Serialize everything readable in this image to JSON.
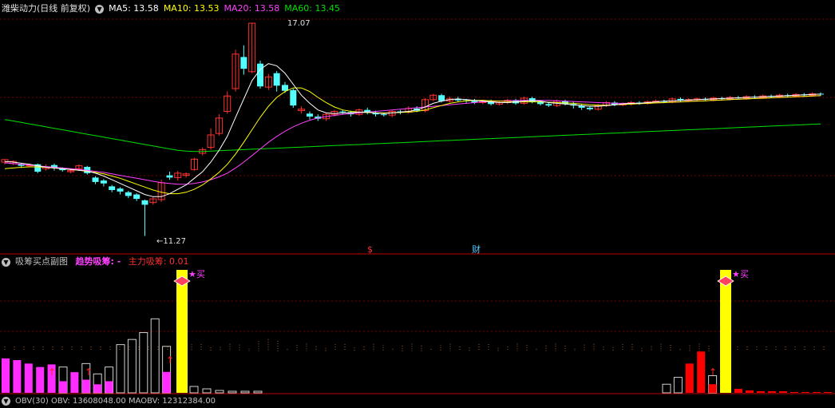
{
  "header": {
    "stock_title": "潍柴动力(日线 前复权)",
    "ma5": "MA5: 13.58",
    "ma10": "MA10: 13.53",
    "ma20": "MA20: 13.58",
    "ma60": "MA60: 13.45"
  },
  "sub_header": {
    "name": "吸筹买点副图",
    "trend_label": "趋势吸筹: -",
    "main_label": "主力吸筹: 0.01"
  },
  "obv_header": {
    "text": "OBV(30)  OBV: 13608048.00  MAOBV: 12312384.00"
  },
  "annotations": {
    "high_label": "17.07",
    "low_label": "←11.27",
    "marker_s": "$",
    "marker_cai": "财",
    "buy_label": "买"
  },
  "colors": {
    "up": "#ff3232",
    "down": "#54ffff",
    "ma5": "#ffffff",
    "ma10": "#ffff00",
    "ma20": "#ff40ff",
    "ma60": "#00e000",
    "grid": "#7a0000",
    "highlight": "#ffff00",
    "magenta": "#ff2dff",
    "red": "#ff0000"
  },
  "chart_data": {
    "type": "candlestick",
    "ylim": [
      11.0,
      17.3
    ],
    "candles": [
      [
        13.28,
        13.35,
        13.22,
        13.36
      ],
      [
        13.24,
        13.3,
        13.2,
        13.33
      ],
      [
        13.22,
        13.18,
        13.12,
        13.25
      ],
      [
        13.18,
        13.2,
        13.14,
        13.24
      ],
      [
        13.22,
        13.02,
        12.98,
        13.24
      ],
      [
        13.1,
        13.14,
        13.05,
        13.22
      ],
      [
        13.2,
        13.12,
        13.05,
        13.24
      ],
      [
        13.1,
        13.06,
        13.02,
        13.14
      ],
      [
        13.02,
        13.05,
        12.98,
        13.08
      ],
      [
        13.1,
        13.18,
        13.04,
        13.22
      ],
      [
        13.15,
        12.98,
        12.94,
        13.18
      ],
      [
        12.86,
        12.74,
        12.68,
        12.9
      ],
      [
        12.78,
        12.7,
        12.62,
        12.82
      ],
      [
        12.62,
        12.52,
        12.46,
        12.66
      ],
      [
        12.56,
        12.48,
        12.4,
        12.6
      ],
      [
        12.46,
        12.36,
        12.3,
        12.5
      ],
      [
        12.4,
        12.28,
        12.22,
        12.43
      ],
      [
        12.24,
        12.12,
        11.27,
        12.26
      ],
      [
        12.18,
        12.28,
        12.12,
        12.34
      ],
      [
        12.26,
        12.72,
        12.2,
        12.8
      ],
      [
        12.92,
        12.86,
        12.8,
        13.02
      ],
      [
        12.86,
        12.98,
        12.78,
        13.04
      ],
      [
        12.92,
        12.96,
        12.86,
        13.0
      ],
      [
        13.08,
        13.36,
        13.04,
        13.4
      ],
      [
        13.52,
        13.62,
        13.46,
        13.68
      ],
      [
        13.68,
        14.02,
        13.62,
        14.2
      ],
      [
        14.06,
        14.48,
        14.0,
        14.58
      ],
      [
        14.66,
        15.08,
        14.6,
        15.2
      ],
      [
        15.28,
        16.22,
        15.2,
        16.34
      ],
      [
        16.14,
        15.82,
        15.66,
        16.46
      ],
      [
        15.74,
        17.06,
        15.7,
        17.07
      ],
      [
        15.96,
        15.34,
        15.28,
        16.04
      ],
      [
        15.32,
        15.6,
        15.24,
        15.68
      ],
      [
        15.7,
        15.36,
        15.2,
        15.76
      ],
      [
        15.38,
        15.22,
        15.16,
        15.46
      ],
      [
        15.24,
        14.82,
        14.76,
        15.28
      ],
      [
        14.68,
        14.72,
        14.6,
        14.8
      ],
      [
        14.6,
        14.52,
        14.44,
        14.66
      ],
      [
        14.52,
        14.46,
        14.4,
        14.58
      ],
      [
        14.46,
        14.58,
        14.4,
        14.62
      ],
      [
        14.58,
        14.66,
        14.52,
        14.7
      ],
      [
        14.66,
        14.64,
        14.58,
        14.7
      ],
      [
        14.64,
        14.58,
        14.52,
        14.68
      ],
      [
        14.58,
        14.7,
        14.54,
        14.74
      ],
      [
        14.7,
        14.62,
        14.58,
        14.76
      ],
      [
        14.62,
        14.58,
        14.52,
        14.68
      ],
      [
        14.58,
        14.56,
        14.52,
        14.62
      ],
      [
        14.56,
        14.66,
        14.5,
        14.7
      ],
      [
        14.66,
        14.64,
        14.58,
        14.7
      ],
      [
        14.64,
        14.74,
        14.6,
        14.8
      ],
      [
        14.74,
        14.68,
        14.64,
        14.8
      ],
      [
        14.68,
        14.98,
        14.64,
        15.02
      ],
      [
        14.98,
        15.1,
        14.94,
        15.14
      ],
      [
        15.1,
        14.94,
        14.9,
        15.14
      ],
      [
        14.94,
        15.0,
        14.9,
        15.06
      ],
      [
        15.0,
        14.96,
        14.92,
        15.06
      ],
      [
        14.96,
        14.94,
        14.88,
        15.0
      ],
      [
        14.94,
        14.9,
        14.86,
        15.0
      ],
      [
        14.9,
        14.94,
        14.86,
        14.98
      ],
      [
        14.94,
        14.86,
        14.82,
        14.98
      ],
      [
        14.86,
        14.9,
        14.82,
        14.94
      ],
      [
        14.9,
        14.96,
        14.86,
        15.0
      ],
      [
        14.96,
        14.88,
        14.84,
        15.0
      ],
      [
        14.88,
        15.02,
        14.84,
        15.06
      ],
      [
        15.02,
        14.92,
        14.88,
        15.06
      ],
      [
        14.92,
        14.86,
        14.82,
        14.96
      ],
      [
        14.86,
        14.82,
        14.78,
        14.92
      ],
      [
        14.82,
        14.94,
        14.78,
        14.98
      ],
      [
        14.94,
        14.86,
        14.82,
        14.98
      ],
      [
        14.86,
        14.82,
        14.74,
        14.92
      ],
      [
        14.82,
        14.76,
        14.7,
        14.86
      ],
      [
        14.76,
        14.72,
        14.68,
        14.8
      ],
      [
        14.72,
        14.82,
        14.68,
        14.86
      ],
      [
        14.82,
        14.9,
        14.78,
        14.94
      ],
      [
        14.9,
        14.84,
        14.8,
        14.94
      ],
      [
        14.84,
        14.86,
        14.8,
        14.9
      ],
      [
        14.86,
        14.9,
        14.82,
        14.94
      ],
      [
        14.9,
        14.88,
        14.84,
        14.94
      ],
      [
        14.88,
        14.92,
        14.84,
        14.96
      ],
      [
        14.92,
        14.94,
        14.88,
        14.98
      ],
      [
        14.94,
        14.92,
        14.88,
        14.98
      ],
      [
        14.92,
        15.0,
        14.88,
        15.04
      ],
      [
        15.0,
        14.96,
        14.92,
        15.04
      ],
      [
        14.96,
        14.98,
        14.92,
        15.02
      ],
      [
        14.98,
        15.0,
        14.94,
        15.04
      ],
      [
        15.0,
        14.98,
        14.94,
        15.04
      ],
      [
        14.98,
        15.02,
        14.94,
        15.06
      ],
      [
        15.02,
        15.0,
        14.96,
        15.06
      ],
      [
        15.0,
        15.04,
        14.96,
        15.08
      ],
      [
        15.04,
        15.02,
        14.98,
        15.08
      ],
      [
        15.02,
        15.06,
        14.98,
        15.1
      ],
      [
        15.06,
        15.04,
        15.0,
        15.1
      ],
      [
        15.04,
        15.08,
        15.0,
        15.12
      ],
      [
        15.08,
        15.06,
        15.02,
        15.12
      ],
      [
        15.06,
        15.1,
        15.02,
        15.14
      ],
      [
        15.1,
        15.08,
        15.04,
        15.14
      ],
      [
        15.08,
        15.12,
        15.04,
        15.16
      ],
      [
        15.12,
        15.1,
        15.06,
        15.16
      ],
      [
        15.1,
        15.14,
        15.06,
        15.18
      ],
      [
        15.14,
        15.12,
        15.08,
        15.18
      ]
    ],
    "ma5": [
      13.3,
      13.28,
      13.25,
      13.22,
      13.18,
      13.14,
      13.12,
      13.1,
      13.08,
      13.06,
      13.04,
      12.98,
      12.9,
      12.8,
      12.7,
      12.6,
      12.5,
      12.4,
      12.34,
      12.34,
      12.42,
      12.54,
      12.66,
      12.84,
      13.02,
      13.28,
      13.6,
      13.98,
      14.5,
      15.0,
      15.5,
      15.8,
      15.96,
      15.9,
      15.7,
      15.4,
      15.1,
      14.88,
      14.7,
      14.62,
      14.6,
      14.62,
      14.62,
      14.64,
      14.64,
      14.62,
      14.6,
      14.62,
      14.64,
      14.66,
      14.7,
      14.78,
      14.88,
      14.94,
      14.98,
      15.0,
      14.98,
      14.96,
      14.94,
      14.92,
      14.9,
      14.9,
      14.92,
      14.94,
      14.96,
      14.94,
      14.9,
      14.88,
      14.86,
      14.84,
      14.82,
      14.8,
      14.8,
      14.82,
      14.84,
      14.86,
      14.88,
      14.88,
      14.9,
      14.92,
      14.94,
      14.95,
      14.96,
      14.97,
      14.98,
      14.99,
      15.0,
      15.01,
      15.02,
      15.03,
      15.04,
      15.05,
      15.06,
      15.07,
      15.08,
      15.09,
      15.1,
      15.11,
      15.12,
      15.13
    ],
    "ma10": [
      13.1,
      13.12,
      13.14,
      13.15,
      13.15,
      13.14,
      13.12,
      13.1,
      13.08,
      13.06,
      13.03,
      13.0,
      12.96,
      12.9,
      12.84,
      12.76,
      12.68,
      12.6,
      12.52,
      12.46,
      12.42,
      12.42,
      12.46,
      12.54,
      12.66,
      12.82,
      13.0,
      13.22,
      13.5,
      13.82,
      14.16,
      14.5,
      14.8,
      15.04,
      15.2,
      15.3,
      15.3,
      15.2,
      15.04,
      14.9,
      14.78,
      14.7,
      14.66,
      14.64,
      14.63,
      14.62,
      14.62,
      14.62,
      14.63,
      14.64,
      14.66,
      14.7,
      14.76,
      14.82,
      14.88,
      14.92,
      14.95,
      14.96,
      14.96,
      14.95,
      14.94,
      14.93,
      14.92,
      14.92,
      14.92,
      14.92,
      14.91,
      14.9,
      14.89,
      14.88,
      14.86,
      14.84,
      14.83,
      14.83,
      14.84,
      14.85,
      14.86,
      14.87,
      14.88,
      14.89,
      14.9,
      14.91,
      14.92,
      14.93,
      14.94,
      14.95,
      14.96,
      14.97,
      14.98,
      14.99,
      15.0,
      15.01,
      15.02,
      15.03,
      15.04,
      15.05,
      15.06,
      15.07,
      15.08,
      15.09
    ],
    "ma20": [
      13.26,
      13.24,
      13.22,
      13.2,
      13.18,
      13.16,
      13.14,
      13.12,
      13.1,
      13.08,
      13.06,
      13.03,
      13.0,
      12.96,
      12.92,
      12.88,
      12.84,
      12.8,
      12.76,
      12.72,
      12.7,
      12.68,
      12.68,
      12.7,
      12.74,
      12.8,
      12.88,
      12.98,
      13.12,
      13.28,
      13.46,
      13.64,
      13.82,
      13.98,
      14.12,
      14.24,
      14.34,
      14.42,
      14.48,
      14.52,
      14.55,
      14.58,
      14.6,
      14.62,
      14.64,
      14.66,
      14.68,
      14.7,
      14.72,
      14.74,
      14.76,
      14.78,
      14.8,
      14.82,
      14.84,
      14.86,
      14.88,
      14.9,
      14.92,
      14.93,
      14.94,
      14.95,
      14.96,
      14.96,
      14.96,
      14.96,
      14.96,
      14.95,
      14.94,
      14.93,
      14.92,
      14.91,
      14.9,
      14.89,
      14.88,
      14.88,
      14.88,
      14.88,
      14.88,
      14.89,
      14.9,
      14.91,
      14.92,
      14.93,
      14.94,
      14.95,
      14.96,
      14.97,
      14.98,
      14.99,
      15.0,
      15.01,
      15.02,
      15.03,
      15.04,
      15.05,
      15.06,
      15.07,
      15.08,
      15.09
    ],
    "ma60": [
      14.44,
      14.4,
      14.36,
      14.32,
      14.28,
      14.24,
      14.2,
      14.16,
      14.12,
      14.08,
      14.04,
      14.0,
      13.96,
      13.92,
      13.88,
      13.84,
      13.8,
      13.76,
      13.72,
      13.68,
      13.64,
      13.6,
      13.58,
      13.57,
      13.57,
      13.58,
      13.59,
      13.6,
      13.61,
      13.62,
      13.63,
      13.64,
      13.65,
      13.66,
      13.67,
      13.68,
      13.69,
      13.7,
      13.71,
      13.72,
      13.73,
      13.74,
      13.75,
      13.76,
      13.77,
      13.78,
      13.79,
      13.8,
      13.81,
      13.82,
      13.83,
      13.84,
      13.85,
      13.86,
      13.87,
      13.88,
      13.89,
      13.9,
      13.91,
      13.92,
      13.93,
      13.94,
      13.95,
      13.96,
      13.97,
      13.98,
      13.99,
      14.0,
      14.01,
      14.02,
      14.03,
      14.04,
      14.05,
      14.06,
      14.07,
      14.08,
      14.09,
      14.1,
      14.11,
      14.12,
      14.13,
      14.14,
      14.15,
      14.16,
      14.17,
      14.18,
      14.19,
      14.2,
      14.21,
      14.22,
      14.23,
      14.24,
      14.25,
      14.26,
      14.27,
      14.28,
      14.29,
      14.3,
      14.31,
      14.32
    ],
    "sub_bars_left": [
      {
        "h": 0.4,
        "fill": "magenta"
      },
      {
        "h": 0.38,
        "fill": "magenta"
      },
      {
        "h": 0.34,
        "fill": "magenta"
      },
      {
        "h": 0.3,
        "fill": "magenta"
      },
      {
        "h": 0.33,
        "fill": "magenta"
      },
      {
        "h": 0.3,
        "fill": "mixed"
      },
      {
        "h": 0.24,
        "fill": "magenta"
      },
      {
        "h": 0.34,
        "fill": "mixed"
      },
      {
        "h": 0.22,
        "fill": "mixed"
      },
      {
        "h": 0.3,
        "fill": "mixed"
      },
      {
        "h": 0.56,
        "fill": "outline"
      },
      {
        "h": 0.62,
        "fill": "outline"
      },
      {
        "h": 0.7,
        "fill": "outline"
      },
      {
        "h": 0.86,
        "fill": "outline"
      },
      {
        "h": 0.54,
        "fill": "mixed"
      }
    ],
    "sub_bars_right": [
      {
        "h": 0.1,
        "fill": "outline"
      },
      {
        "h": 0.18,
        "fill": "outline"
      },
      {
        "h": 0.34,
        "fill": "red"
      },
      {
        "h": 0.48,
        "fill": "red"
      },
      {
        "h": 0.2,
        "fill": "mixed"
      }
    ]
  }
}
